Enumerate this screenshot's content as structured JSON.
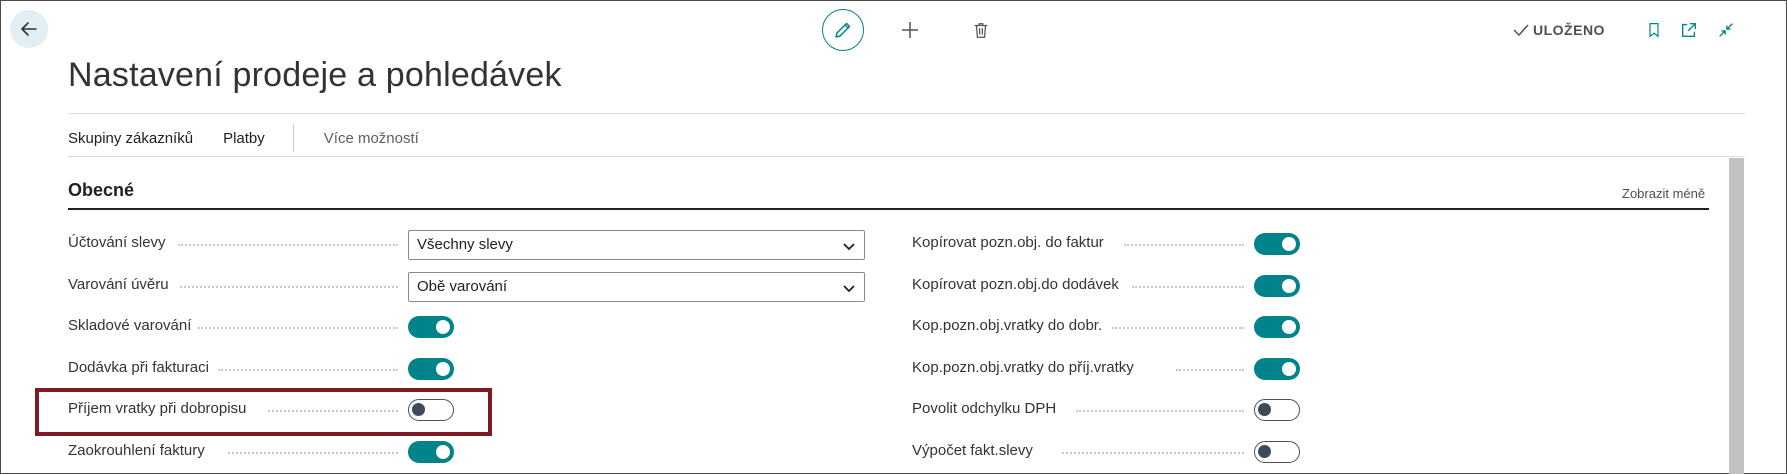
{
  "header": {
    "saved_label": "ULOŽENO",
    "title": "Nastavení prodeje a pohledávek"
  },
  "actions": {
    "items": [
      "Skupiny zákazníků",
      "Platby"
    ],
    "more_label": "Více možností"
  },
  "section": {
    "title": "Obecné",
    "collapse_label": "Zobrazit méně"
  },
  "fields_left": [
    {
      "label": "Účtování slevy",
      "type": "select",
      "value": "Všechny slevy"
    },
    {
      "label": "Varování úvěru",
      "type": "select",
      "value": "Obě varování"
    },
    {
      "label": "Skladové varování",
      "type": "toggle",
      "value": true
    },
    {
      "label": "Dodávka při fakturaci",
      "type": "toggle",
      "value": true
    },
    {
      "label": "Příjem vratky při dobropisu",
      "type": "toggle",
      "value": false
    },
    {
      "label": "Zaokrouhlení faktury",
      "type": "toggle",
      "value": true
    }
  ],
  "fields_right": [
    {
      "label": "Kopírovat pozn.obj. do faktur",
      "type": "toggle",
      "value": true
    },
    {
      "label": "Kopírovat pozn.obj.do dodávek",
      "type": "toggle",
      "value": true
    },
    {
      "label": "Kop.pozn.obj.vratky do dobr.",
      "type": "toggle",
      "value": true
    },
    {
      "label": "Kop.pozn.obj.vratky do příj.vratky",
      "type": "toggle",
      "value": true
    },
    {
      "label": "Povolit odchylku DPH",
      "type": "toggle",
      "value": false
    },
    {
      "label": "Výpočet fakt.slevy",
      "type": "toggle",
      "value": false
    }
  ],
  "colors": {
    "accent": "#008489",
    "highlight_box": "#7d1a24"
  },
  "icons": {
    "back": "arrow-left-icon",
    "edit": "pencil-icon",
    "new": "plus-icon",
    "delete": "trash-icon",
    "saved": "checkmark-icon",
    "bookmark": "bookmark-icon",
    "open_new": "open-in-new-window-icon",
    "collapse": "collapse-icon"
  }
}
